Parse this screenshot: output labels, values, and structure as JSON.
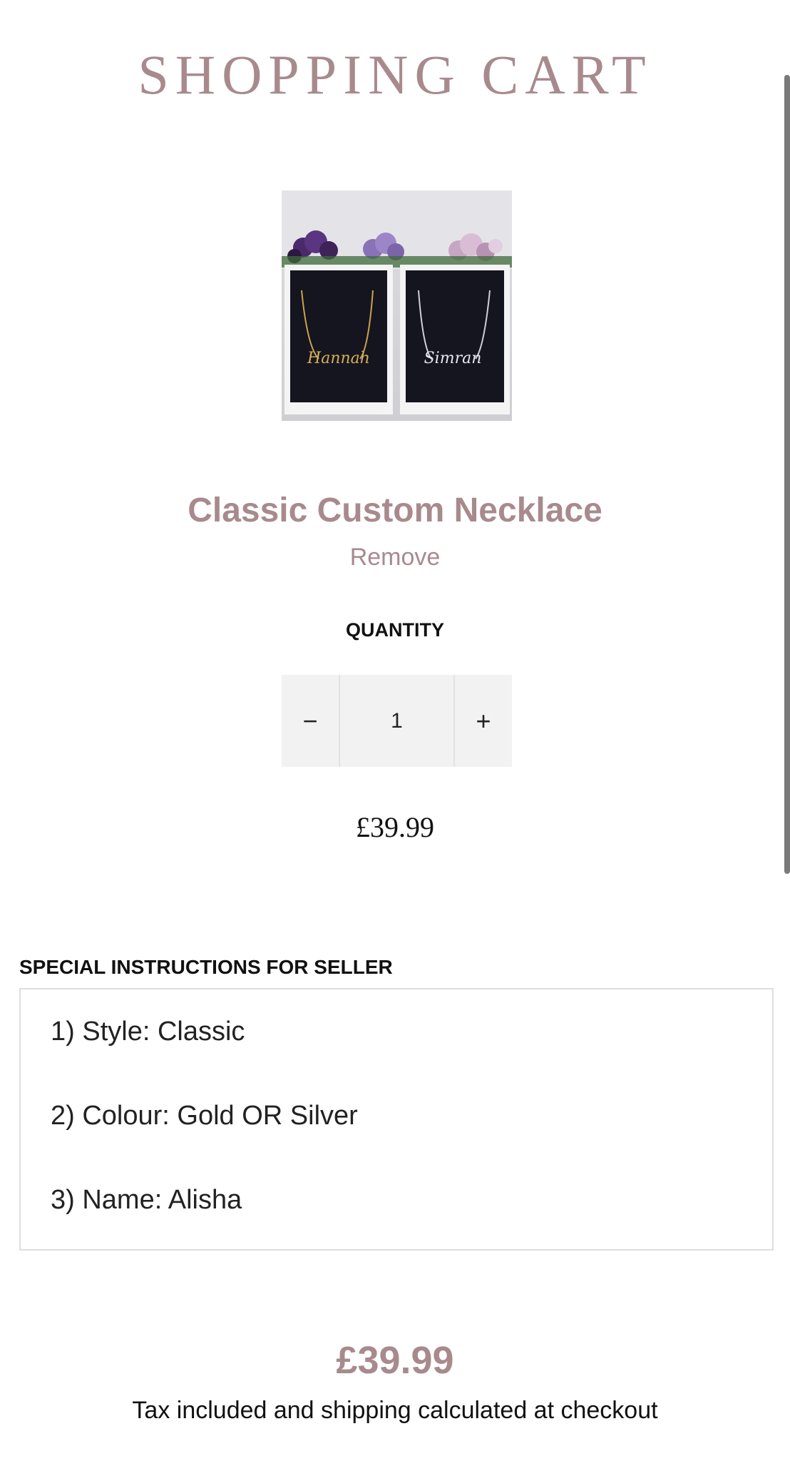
{
  "header": {
    "title": "SHOPPING CART"
  },
  "cart": {
    "item": {
      "name": "Classic Custom Necklace",
      "remove_label": "Remove",
      "image_alt_names": [
        "Hannah",
        "Simran"
      ],
      "quantity_label": "QUANTITY",
      "quantity": "1",
      "decrement_symbol": "−",
      "increment_symbol": "+",
      "price": "£39.99"
    }
  },
  "instructions": {
    "label": "SPECIAL INSTRUCTIONS FOR SELLER",
    "lines": [
      "1)  Style: Classic",
      "2) Colour: Gold OR Silver",
      "3)  Name: Alisha"
    ]
  },
  "summary": {
    "total": "£39.99",
    "tax_note": "Tax included and shipping calculated at checkout"
  },
  "colors": {
    "accent": "#a88a8d",
    "text": "#111111",
    "stepper_bg": "#f2f2f2",
    "border": "#dedede"
  }
}
